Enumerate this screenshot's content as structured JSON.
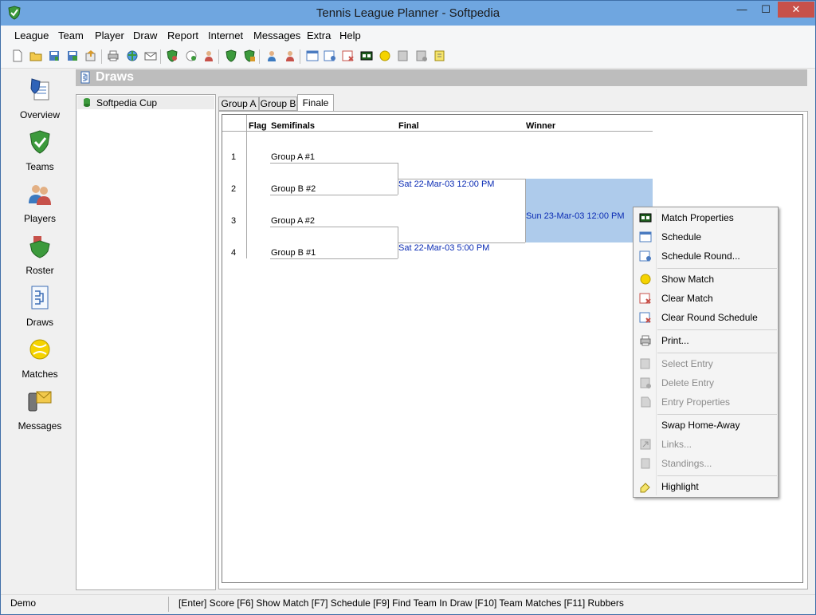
{
  "window": {
    "title": "Tennis League Planner - Softpedia",
    "min_glyph": "—",
    "max_glyph": "☐",
    "close_glyph": "✕"
  },
  "menu": [
    "League",
    "Team",
    "Player",
    "Draw",
    "Report",
    "Internet",
    "Messages",
    "Extra",
    "Help"
  ],
  "toolbar_icons": [
    "new-icon",
    "open-icon",
    "save-icon",
    "save-as-icon",
    "export-icon",
    "print-icon",
    "web-icon",
    "email-icon",
    "league-icon",
    "ball-icon",
    "player-icon",
    "team-add-icon",
    "team-edit-icon",
    "player-add-icon",
    "player-edit-icon",
    "schedule-icon",
    "schedule-round-icon",
    "clear-schedule-icon",
    "score-icon",
    "show-match-icon",
    "entry-icon",
    "entry-delete-icon",
    "highlight-icon"
  ],
  "nav": [
    {
      "label": "Overview",
      "icon": "overview-icon"
    },
    {
      "label": "Teams",
      "icon": "teams-shield-icon"
    },
    {
      "label": "Players",
      "icon": "players-icon"
    },
    {
      "label": "Roster",
      "icon": "roster-icon"
    },
    {
      "label": "Draws",
      "icon": "draws-icon"
    },
    {
      "label": "Matches",
      "icon": "matches-ball-icon"
    },
    {
      "label": "Messages",
      "icon": "messages-phone-icon"
    }
  ],
  "page": {
    "title": "Draws"
  },
  "tree": {
    "items": [
      {
        "label": "Softpedia Cup"
      }
    ]
  },
  "tabs": [
    {
      "label": "Group A",
      "active": false
    },
    {
      "label": "Group B",
      "active": false
    },
    {
      "label": "Finale",
      "active": true
    }
  ],
  "draw": {
    "headers": {
      "flag": "Flag",
      "semifinals": "Semifinals",
      "final": "Final",
      "winner": "Winner"
    },
    "rows": [
      {
        "num": "1",
        "team": "Group A #1"
      },
      {
        "num": "2",
        "team": "Group B #2"
      },
      {
        "num": "3",
        "team": "Group A #2"
      },
      {
        "num": "4",
        "team": "Group B #1"
      }
    ],
    "final_matches": [
      "Sat 22-Mar-03 12:00 PM",
      "Sat 22-Mar-03 5:00 PM"
    ],
    "winner_match": "Sun 23-Mar-03 12:00 PM"
  },
  "context_menu": {
    "items": [
      {
        "label": "Match Properties",
        "icon": "score-icon",
        "enabled": true
      },
      {
        "label": "Schedule",
        "icon": "schedule-icon",
        "enabled": true
      },
      {
        "label": "Schedule Round...",
        "icon": "schedule-round-icon",
        "enabled": true
      },
      {
        "label": "Show Match",
        "icon": "show-match-icon",
        "enabled": true
      },
      {
        "label": "Clear Match",
        "icon": "clear-match-icon",
        "enabled": true
      },
      {
        "label": "Clear Round Schedule",
        "icon": "clear-round-icon",
        "enabled": true
      },
      {
        "label": "Print...",
        "icon": "print-icon",
        "enabled": true
      },
      {
        "label": "Select Entry",
        "icon": "select-entry-icon",
        "enabled": false
      },
      {
        "label": "Delete Entry",
        "icon": "delete-entry-icon",
        "enabled": false
      },
      {
        "label": "Entry Properties",
        "icon": "entry-properties-icon",
        "enabled": false
      },
      {
        "label": "Swap Home-Away",
        "icon": "",
        "enabled": true
      },
      {
        "label": "Links...",
        "icon": "links-icon",
        "enabled": false
      },
      {
        "label": "Standings...",
        "icon": "standings-icon",
        "enabled": false
      },
      {
        "label": "Highlight",
        "icon": "highlight-icon",
        "enabled": true
      }
    ]
  },
  "status": {
    "mode": "Demo",
    "shortcuts": "[Enter] Score [F6] Show Match [F7] Schedule [F9] Find Team In Draw [F10] Team Matches [F11] Rubbers"
  }
}
